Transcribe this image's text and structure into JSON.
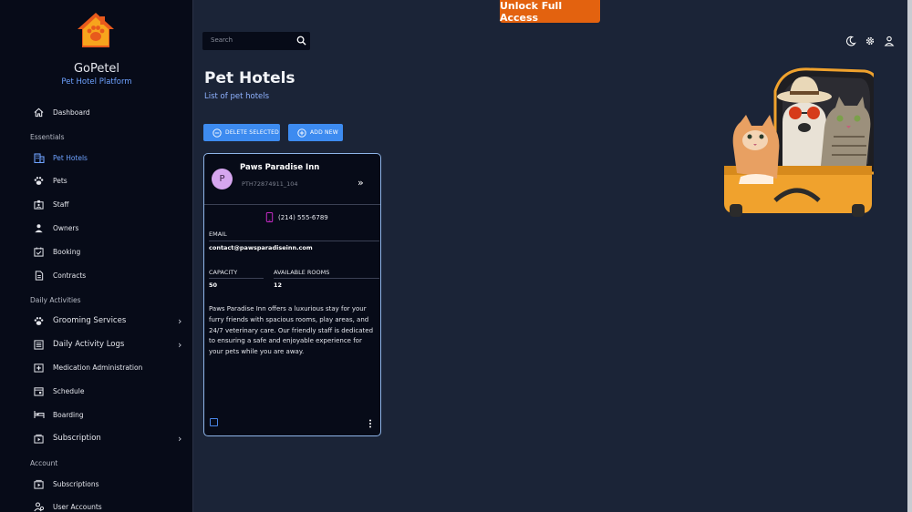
{
  "app": {
    "name": "GoPetel",
    "subtitle": "Pet Hotel Platform"
  },
  "topbar": {
    "unlock_label": "Unlock Full Access",
    "search_placeholder": "Search"
  },
  "sidebar": {
    "top": [
      {
        "label": "Dashboard",
        "icon": "home-icon"
      }
    ],
    "sections": [
      {
        "title": "Essentials",
        "items": [
          {
            "label": "Pet Hotels",
            "icon": "building-icon",
            "active": true
          },
          {
            "label": "Pets",
            "icon": "paw-icon"
          },
          {
            "label": "Staff",
            "icon": "badge-icon"
          },
          {
            "label": "Owners",
            "icon": "person-icon"
          },
          {
            "label": "Booking",
            "icon": "calendar-check-icon"
          },
          {
            "label": "Contracts",
            "icon": "document-icon"
          }
        ]
      },
      {
        "title": "Daily Activities",
        "items": [
          {
            "label": "Grooming Services",
            "icon": "paw-icon",
            "expandable": true
          },
          {
            "label": "Daily Activity Logs",
            "icon": "list-icon",
            "expandable": true
          },
          {
            "label": "Medication Administration",
            "icon": "medication-icon"
          },
          {
            "label": "Schedule",
            "icon": "calendar-icon"
          },
          {
            "label": "Boarding",
            "icon": "bed-icon"
          },
          {
            "label": "Subscription",
            "icon": "subscription-icon",
            "expandable": true
          }
        ]
      },
      {
        "title": "Account",
        "items": [
          {
            "label": "Subscriptions",
            "icon": "subscriptions-icon"
          },
          {
            "label": "User Accounts",
            "icon": "users-icon"
          }
        ]
      }
    ]
  },
  "page": {
    "title": "Pet Hotels",
    "subtitle": "List of pet hotels",
    "delete_label": "DELETE SELECTED",
    "add_label": "ADD NEW"
  },
  "card": {
    "avatar_letter": "P",
    "name": "Paws Paradise Inn",
    "id": "PTH72874911_104",
    "phone": "(214) 555-6789",
    "email_label": "EMAIL",
    "email": "contact@pawsparadiseinn.com",
    "capacity_label": "CAPACITY",
    "capacity": "50",
    "rooms_label": "AVAILABLE ROOMS",
    "rooms": "12",
    "description": "Paws Paradise Inn offers a luxurious stay for your furry friends with spacious rooms, play areas, and 24/7 veterinary care. Our friendly staff is dedicated to ensuring a safe and enjoyable experience for your pets while you are away."
  },
  "colors": {
    "accent": "#3d8bf0",
    "unlock": "#e3620f",
    "sidebar": "#070b18",
    "background": "#1b2437",
    "active_nav": "#6ea2ff"
  }
}
